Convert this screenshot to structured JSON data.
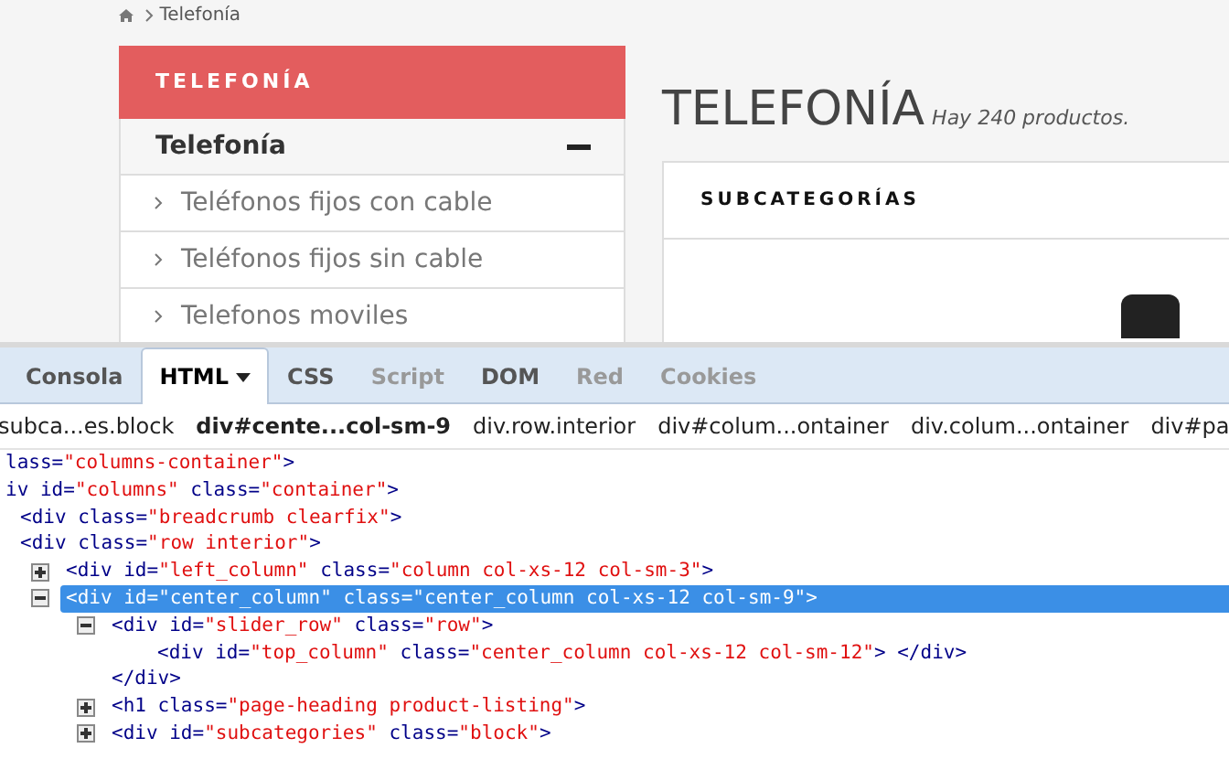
{
  "breadcrumb": {
    "current": "Telefonía"
  },
  "category_block": {
    "title": "TELEFONÍA",
    "parent": {
      "label": "Telefonía",
      "expanded": true
    },
    "items": [
      {
        "label": "Teléfonos fijos con cable"
      },
      {
        "label": "Teléfonos fijos sin cable"
      },
      {
        "label": "Telefonos moviles"
      }
    ]
  },
  "page_heading": {
    "title": "TELEFONÍA",
    "count": "Hay 240 productos."
  },
  "subcategories": {
    "title": "SUBCATEGORÍAS"
  },
  "devtools": {
    "tabs": [
      {
        "label": "Consola",
        "selected": false,
        "disabled": false
      },
      {
        "label": "HTML",
        "selected": true,
        "disabled": false,
        "menu": true
      },
      {
        "label": "CSS",
        "selected": false,
        "disabled": false
      },
      {
        "label": "Script",
        "selected": false,
        "disabled": true
      },
      {
        "label": "DOM",
        "selected": false,
        "disabled": false
      },
      {
        "label": "Red",
        "selected": false,
        "disabled": true
      },
      {
        "label": "Cookies",
        "selected": false,
        "disabled": true
      }
    ],
    "path": [
      {
        "label": "subca...es.block",
        "selected": false
      },
      {
        "label": "div#cente...col-sm-9",
        "selected": true
      },
      {
        "label": "div.row.interior",
        "selected": false
      },
      {
        "label": "div#colum...ontainer",
        "selected": false
      },
      {
        "label": "div.colum...ontainer",
        "selected": false
      },
      {
        "label": "div#pa",
        "selected": false
      }
    ],
    "tree": [
      {
        "parts": [
          {
            "kind": "markup",
            "text": "lass="
          },
          {
            "kind": "value",
            "text": "\"columns-container\""
          },
          {
            "kind": "markup",
            "text": ">"
          }
        ],
        "selected": false
      },
      {
        "parts": [
          {
            "kind": "markup",
            "text": "iv id="
          },
          {
            "kind": "value",
            "text": "\"columns\""
          },
          {
            "kind": "markup",
            "text": " class="
          },
          {
            "kind": "value",
            "text": "\"container\""
          },
          {
            "kind": "markup",
            "text": ">"
          }
        ],
        "selected": false,
        "children": [
          {
            "parts": [
              {
                "kind": "markup",
                "text": "<div class="
              },
              {
                "kind": "value",
                "text": "\"breadcrumb clearfix\""
              },
              {
                "kind": "markup",
                "text": ">"
              }
            ],
            "selected": false
          },
          {
            "parts": [
              {
                "kind": "markup",
                "text": "<div class="
              },
              {
                "kind": "value",
                "text": "\"row interior\""
              },
              {
                "kind": "markup",
                "text": ">"
              }
            ],
            "selected": false,
            "children": [
              {
                "parts": [
                  {
                    "kind": "markup",
                    "text": "<div id="
                  },
                  {
                    "kind": "value",
                    "text": "\"left_column\""
                  },
                  {
                    "kind": "markup",
                    "text": " class="
                  },
                  {
                    "kind": "value",
                    "text": "\"column col-xs-12 col-sm-3\""
                  },
                  {
                    "kind": "markup",
                    "text": ">"
                  }
                ],
                "selected": false,
                "expanded": false
              },
              {
                "parts": [
                  {
                    "kind": "markup",
                    "text": "<div id="
                  },
                  {
                    "kind": "value",
                    "text": "\"center_column\""
                  },
                  {
                    "kind": "markup",
                    "text": " class="
                  },
                  {
                    "kind": "value",
                    "text": "\"center_column col-xs-12 col-sm-9\""
                  },
                  {
                    "kind": "markup",
                    "text": ">"
                  }
                ],
                "selected": true,
                "expanded": true,
                "children": [
                  {
                    "parts": [
                      {
                        "kind": "markup",
                        "text": "<div id="
                      },
                      {
                        "kind": "value",
                        "text": "\"slider_row\""
                      },
                      {
                        "kind": "markup",
                        "text": " class="
                      },
                      {
                        "kind": "value",
                        "text": "\"row\""
                      },
                      {
                        "kind": "markup",
                        "text": ">"
                      }
                    ],
                    "selected": false,
                    "expanded": true,
                    "children": [
                      {
                        "parts": [
                          {
                            "kind": "markup",
                            "text": "<div id="
                          },
                          {
                            "kind": "value",
                            "text": "\"top_column\""
                          },
                          {
                            "kind": "markup",
                            "text": " class="
                          },
                          {
                            "kind": "value",
                            "text": "\"center_column col-xs-12 col-sm-12\""
                          },
                          {
                            "kind": "markup",
                            "text": "> </div>"
                          }
                        ],
                        "selected": false
                      }
                    ],
                    "closing": "</div>"
                  },
                  {
                    "parts": [
                      {
                        "kind": "markup",
                        "text": "<h1 class="
                      },
                      {
                        "kind": "value",
                        "text": "\"page-heading product-listing\""
                      },
                      {
                        "kind": "markup",
                        "text": ">"
                      }
                    ],
                    "selected": false,
                    "expanded": false
                  },
                  {
                    "parts": [
                      {
                        "kind": "markup",
                        "text": "<div id="
                      },
                      {
                        "kind": "value",
                        "text": "\"subcategories\""
                      },
                      {
                        "kind": "markup",
                        "text": " class="
                      },
                      {
                        "kind": "value",
                        "text": "\"block\""
                      },
                      {
                        "kind": "markup",
                        "text": ">"
                      }
                    ],
                    "selected": false,
                    "expanded": false
                  }
                ]
              }
            ]
          }
        ]
      }
    ]
  }
}
